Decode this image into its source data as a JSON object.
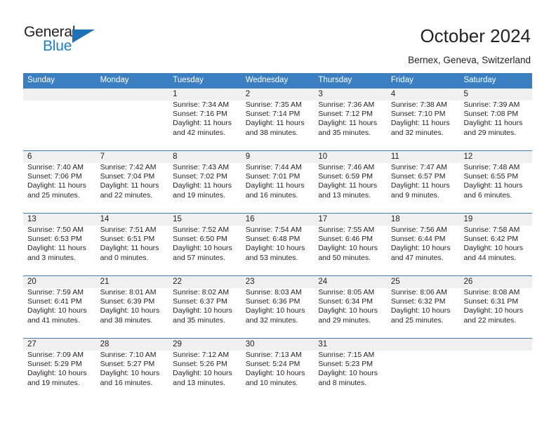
{
  "brand": {
    "name_top": "General",
    "name_bottom": "Blue",
    "accent_color": "#1c7fd6",
    "triangle_color": "#1c72b8"
  },
  "header": {
    "title": "October 2024",
    "subtitle": "Bernex, Geneva, Switzerland"
  },
  "calendar": {
    "header_bg": "#3a7fc1",
    "header_text_color": "#ffffff",
    "row_band_color": "#f0f0f0",
    "weekdays": [
      "Sunday",
      "Monday",
      "Tuesday",
      "Wednesday",
      "Thursday",
      "Friday",
      "Saturday"
    ],
    "weeks": [
      [
        {
          "day": "",
          "sunrise": "",
          "sunset": "",
          "daylight_line1": "",
          "daylight_line2": ""
        },
        {
          "day": "",
          "sunrise": "",
          "sunset": "",
          "daylight_line1": "",
          "daylight_line2": ""
        },
        {
          "day": "1",
          "sunrise": "Sunrise: 7:34 AM",
          "sunset": "Sunset: 7:16 PM",
          "daylight_line1": "Daylight: 11 hours",
          "daylight_line2": "and 42 minutes."
        },
        {
          "day": "2",
          "sunrise": "Sunrise: 7:35 AM",
          "sunset": "Sunset: 7:14 PM",
          "daylight_line1": "Daylight: 11 hours",
          "daylight_line2": "and 38 minutes."
        },
        {
          "day": "3",
          "sunrise": "Sunrise: 7:36 AM",
          "sunset": "Sunset: 7:12 PM",
          "daylight_line1": "Daylight: 11 hours",
          "daylight_line2": "and 35 minutes."
        },
        {
          "day": "4",
          "sunrise": "Sunrise: 7:38 AM",
          "sunset": "Sunset: 7:10 PM",
          "daylight_line1": "Daylight: 11 hours",
          "daylight_line2": "and 32 minutes."
        },
        {
          "day": "5",
          "sunrise": "Sunrise: 7:39 AM",
          "sunset": "Sunset: 7:08 PM",
          "daylight_line1": "Daylight: 11 hours",
          "daylight_line2": "and 29 minutes."
        }
      ],
      [
        {
          "day": "6",
          "sunrise": "Sunrise: 7:40 AM",
          "sunset": "Sunset: 7:06 PM",
          "daylight_line1": "Daylight: 11 hours",
          "daylight_line2": "and 25 minutes."
        },
        {
          "day": "7",
          "sunrise": "Sunrise: 7:42 AM",
          "sunset": "Sunset: 7:04 PM",
          "daylight_line1": "Daylight: 11 hours",
          "daylight_line2": "and 22 minutes."
        },
        {
          "day": "8",
          "sunrise": "Sunrise: 7:43 AM",
          "sunset": "Sunset: 7:02 PM",
          "daylight_line1": "Daylight: 11 hours",
          "daylight_line2": "and 19 minutes."
        },
        {
          "day": "9",
          "sunrise": "Sunrise: 7:44 AM",
          "sunset": "Sunset: 7:01 PM",
          "daylight_line1": "Daylight: 11 hours",
          "daylight_line2": "and 16 minutes."
        },
        {
          "day": "10",
          "sunrise": "Sunrise: 7:46 AM",
          "sunset": "Sunset: 6:59 PM",
          "daylight_line1": "Daylight: 11 hours",
          "daylight_line2": "and 13 minutes."
        },
        {
          "day": "11",
          "sunrise": "Sunrise: 7:47 AM",
          "sunset": "Sunset: 6:57 PM",
          "daylight_line1": "Daylight: 11 hours",
          "daylight_line2": "and 9 minutes."
        },
        {
          "day": "12",
          "sunrise": "Sunrise: 7:48 AM",
          "sunset": "Sunset: 6:55 PM",
          "daylight_line1": "Daylight: 11 hours",
          "daylight_line2": "and 6 minutes."
        }
      ],
      [
        {
          "day": "13",
          "sunrise": "Sunrise: 7:50 AM",
          "sunset": "Sunset: 6:53 PM",
          "daylight_line1": "Daylight: 11 hours",
          "daylight_line2": "and 3 minutes."
        },
        {
          "day": "14",
          "sunrise": "Sunrise: 7:51 AM",
          "sunset": "Sunset: 6:51 PM",
          "daylight_line1": "Daylight: 11 hours",
          "daylight_line2": "and 0 minutes."
        },
        {
          "day": "15",
          "sunrise": "Sunrise: 7:52 AM",
          "sunset": "Sunset: 6:50 PM",
          "daylight_line1": "Daylight: 10 hours",
          "daylight_line2": "and 57 minutes."
        },
        {
          "day": "16",
          "sunrise": "Sunrise: 7:54 AM",
          "sunset": "Sunset: 6:48 PM",
          "daylight_line1": "Daylight: 10 hours",
          "daylight_line2": "and 53 minutes."
        },
        {
          "day": "17",
          "sunrise": "Sunrise: 7:55 AM",
          "sunset": "Sunset: 6:46 PM",
          "daylight_line1": "Daylight: 10 hours",
          "daylight_line2": "and 50 minutes."
        },
        {
          "day": "18",
          "sunrise": "Sunrise: 7:56 AM",
          "sunset": "Sunset: 6:44 PM",
          "daylight_line1": "Daylight: 10 hours",
          "daylight_line2": "and 47 minutes."
        },
        {
          "day": "19",
          "sunrise": "Sunrise: 7:58 AM",
          "sunset": "Sunset: 6:42 PM",
          "daylight_line1": "Daylight: 10 hours",
          "daylight_line2": "and 44 minutes."
        }
      ],
      [
        {
          "day": "20",
          "sunrise": "Sunrise: 7:59 AM",
          "sunset": "Sunset: 6:41 PM",
          "daylight_line1": "Daylight: 10 hours",
          "daylight_line2": "and 41 minutes."
        },
        {
          "day": "21",
          "sunrise": "Sunrise: 8:01 AM",
          "sunset": "Sunset: 6:39 PM",
          "daylight_line1": "Daylight: 10 hours",
          "daylight_line2": "and 38 minutes."
        },
        {
          "day": "22",
          "sunrise": "Sunrise: 8:02 AM",
          "sunset": "Sunset: 6:37 PM",
          "daylight_line1": "Daylight: 10 hours",
          "daylight_line2": "and 35 minutes."
        },
        {
          "day": "23",
          "sunrise": "Sunrise: 8:03 AM",
          "sunset": "Sunset: 6:36 PM",
          "daylight_line1": "Daylight: 10 hours",
          "daylight_line2": "and 32 minutes."
        },
        {
          "day": "24",
          "sunrise": "Sunrise: 8:05 AM",
          "sunset": "Sunset: 6:34 PM",
          "daylight_line1": "Daylight: 10 hours",
          "daylight_line2": "and 29 minutes."
        },
        {
          "day": "25",
          "sunrise": "Sunrise: 8:06 AM",
          "sunset": "Sunset: 6:32 PM",
          "daylight_line1": "Daylight: 10 hours",
          "daylight_line2": "and 25 minutes."
        },
        {
          "day": "26",
          "sunrise": "Sunrise: 8:08 AM",
          "sunset": "Sunset: 6:31 PM",
          "daylight_line1": "Daylight: 10 hours",
          "daylight_line2": "and 22 minutes."
        }
      ],
      [
        {
          "day": "27",
          "sunrise": "Sunrise: 7:09 AM",
          "sunset": "Sunset: 5:29 PM",
          "daylight_line1": "Daylight: 10 hours",
          "daylight_line2": "and 19 minutes."
        },
        {
          "day": "28",
          "sunrise": "Sunrise: 7:10 AM",
          "sunset": "Sunset: 5:27 PM",
          "daylight_line1": "Daylight: 10 hours",
          "daylight_line2": "and 16 minutes."
        },
        {
          "day": "29",
          "sunrise": "Sunrise: 7:12 AM",
          "sunset": "Sunset: 5:26 PM",
          "daylight_line1": "Daylight: 10 hours",
          "daylight_line2": "and 13 minutes."
        },
        {
          "day": "30",
          "sunrise": "Sunrise: 7:13 AM",
          "sunset": "Sunset: 5:24 PM",
          "daylight_line1": "Daylight: 10 hours",
          "daylight_line2": "and 10 minutes."
        },
        {
          "day": "31",
          "sunrise": "Sunrise: 7:15 AM",
          "sunset": "Sunset: 5:23 PM",
          "daylight_line1": "Daylight: 10 hours",
          "daylight_line2": "and 8 minutes."
        },
        {
          "day": "",
          "sunrise": "",
          "sunset": "",
          "daylight_line1": "",
          "daylight_line2": ""
        },
        {
          "day": "",
          "sunrise": "",
          "sunset": "",
          "daylight_line1": "",
          "daylight_line2": ""
        }
      ]
    ]
  }
}
